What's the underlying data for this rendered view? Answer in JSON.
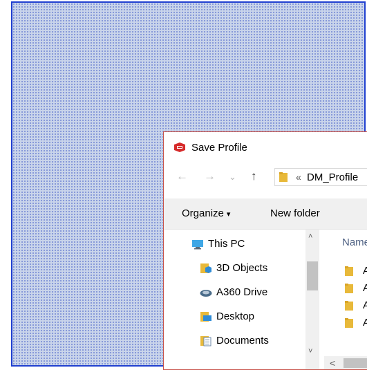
{
  "colors": {
    "canvas_border": "#1f3fd0",
    "canvas_fill": "#c9d4ea",
    "canvas_dots": "#4a63c9",
    "dialog_border": "#c8534a",
    "toolbar_bg": "#f0f0f0",
    "folder_yellow": "#e8b93a"
  },
  "dialog": {
    "title": "Save Profile",
    "app_icon": "sketchup-icon"
  },
  "navigation": {
    "back_icon": "←",
    "forward_icon": "→",
    "recent_icon": "⌄",
    "up_icon": "↑",
    "address_chevron": "«",
    "address_text": "DM_Profile"
  },
  "toolbar": {
    "organize_label": "Organize",
    "organize_caret": "▾",
    "new_folder_label": "New folder"
  },
  "nav_pane": {
    "items": [
      {
        "label": "This PC",
        "icon": "computer-icon"
      },
      {
        "label": "3D Objects",
        "icon": "3d-objects-icon"
      },
      {
        "label": "A360 Drive",
        "icon": "cloud-drive-icon"
      },
      {
        "label": "Desktop",
        "icon": "desktop-icon"
      },
      {
        "label": "Documents",
        "icon": "documents-icon"
      }
    ],
    "scroll_up": "˄",
    "scroll_down": "˅"
  },
  "file_pane": {
    "column_name": "Name",
    "rows": [
      {
        "label": "A",
        "icon": "folder-icon"
      },
      {
        "label": "A",
        "icon": "folder-icon"
      },
      {
        "label": "A",
        "icon": "folder-icon"
      },
      {
        "label": "A",
        "icon": "folder-icon"
      }
    ],
    "scroll_left": "<"
  }
}
